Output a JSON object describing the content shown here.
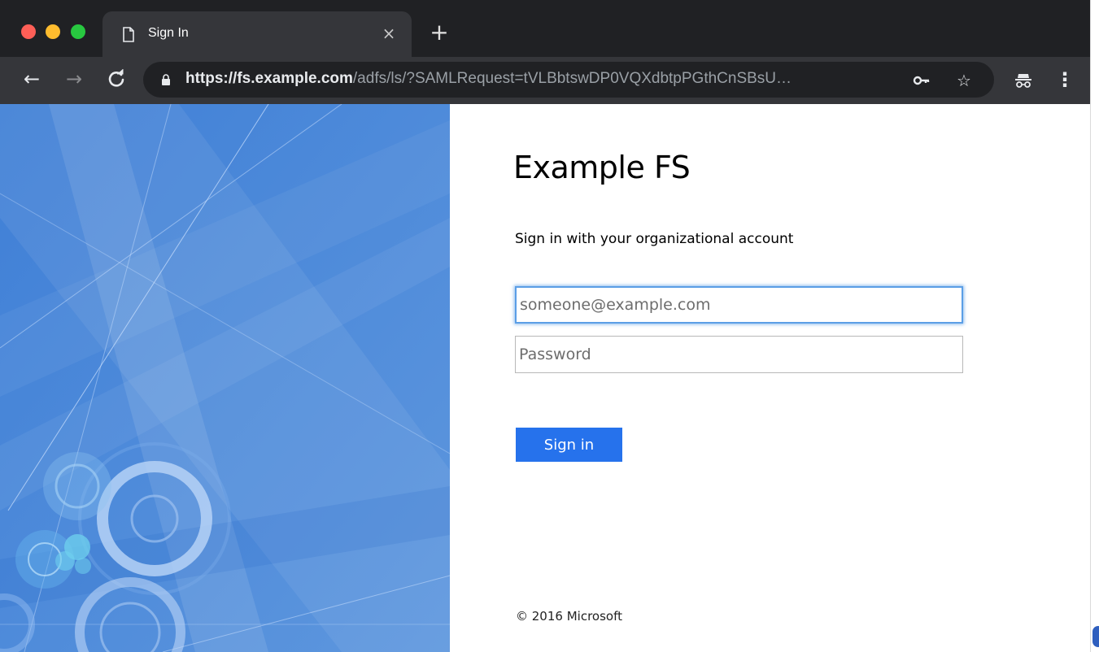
{
  "browser": {
    "tab": {
      "title": "Sign In",
      "close_glyph": "×"
    },
    "new_tab_glyph": "+",
    "nav": {
      "back_glyph": "←",
      "forward_glyph": "→",
      "reload_glyph": "C"
    },
    "address": {
      "scheme": "https://",
      "host": "fs.example.com",
      "rest": "/adfs/ls/?SAMLRequest=tVLBbtswDP0VQXdbtpPGthCnSBsU…"
    },
    "icons": {
      "key": "key-icon",
      "star": "star-icon",
      "incognito": "incognito-icon",
      "menu": "more-vert-icon"
    },
    "glyphs": {
      "key": "⊶",
      "star": "☆",
      "incognito": "ಠ",
      "menu": "⋮"
    }
  },
  "page": {
    "company_name": "Example FS",
    "intro_text": "Sign in with your organizational account",
    "email_placeholder": "someone@example.com",
    "password_placeholder": "Password",
    "submit_label": "Sign in",
    "copyright": "© 2016 Microsoft"
  },
  "colors": {
    "accent": "#2672ec",
    "illustration_bg": "#4f8fdc",
    "tab_strip": "#202124",
    "toolbar": "#35363a"
  }
}
